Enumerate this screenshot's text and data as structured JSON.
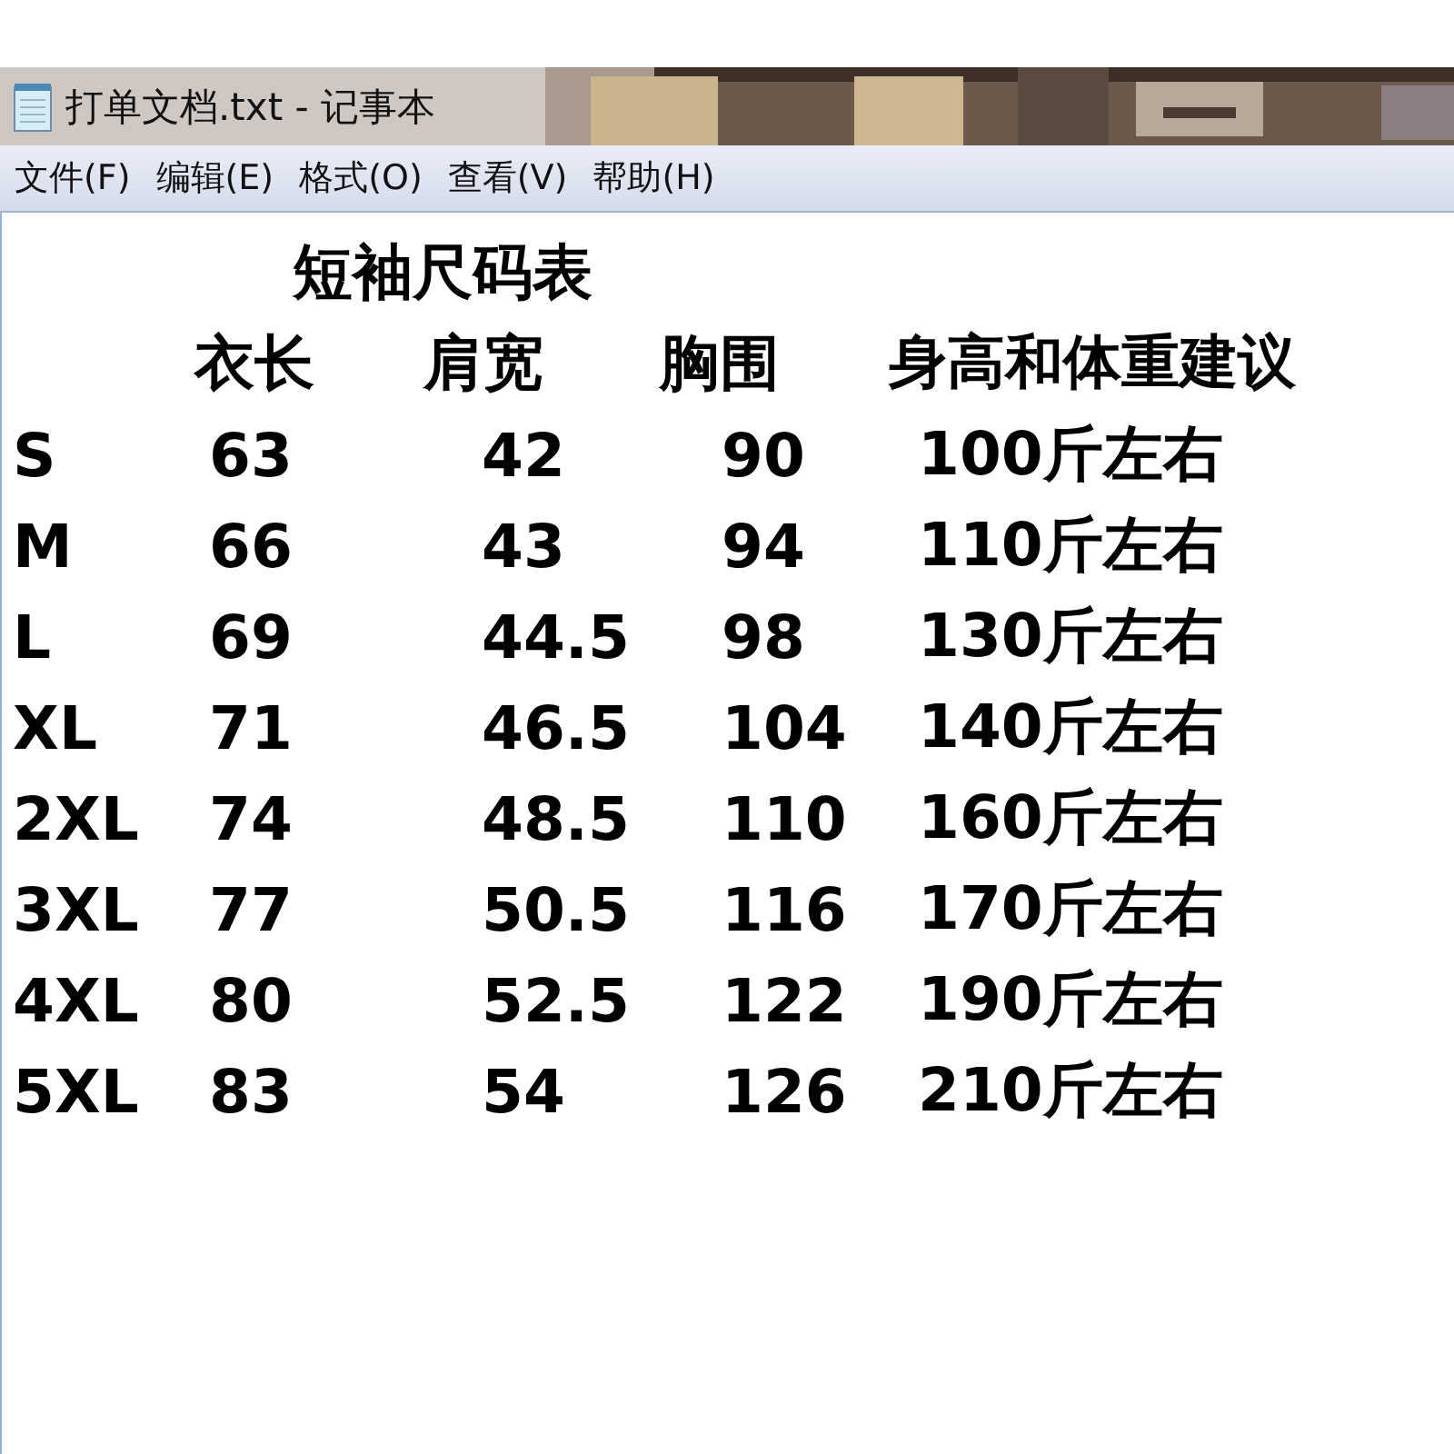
{
  "window": {
    "title": "打单文档.txt - 记事本"
  },
  "menu": [
    "文件(F)",
    "编辑(E)",
    "格式(O)",
    "查看(V)",
    "帮助(H)"
  ],
  "document": {
    "heading": "短袖尺码表",
    "columns": [
      "",
      "衣长",
      "肩宽",
      "胸围",
      "身高和体重建议"
    ],
    "rows": [
      [
        "S",
        "63",
        "42",
        "90",
        "100斤左右"
      ],
      [
        "M",
        "66",
        "43",
        "94",
        "110斤左右"
      ],
      [
        "L",
        "69",
        "44.5",
        "98",
        "130斤左右"
      ],
      [
        "XL",
        "71",
        "46.5",
        "104",
        "140斤左右"
      ],
      [
        "2XL",
        "74",
        "48.5",
        "110",
        "160斤左右"
      ],
      [
        "3XL",
        "77",
        "50.5",
        "116",
        "170斤左右"
      ],
      [
        "4XL",
        "80",
        "52.5",
        "122",
        "190斤左右"
      ],
      [
        "5XL",
        "83",
        "54",
        "126",
        "210斤左右"
      ]
    ]
  }
}
